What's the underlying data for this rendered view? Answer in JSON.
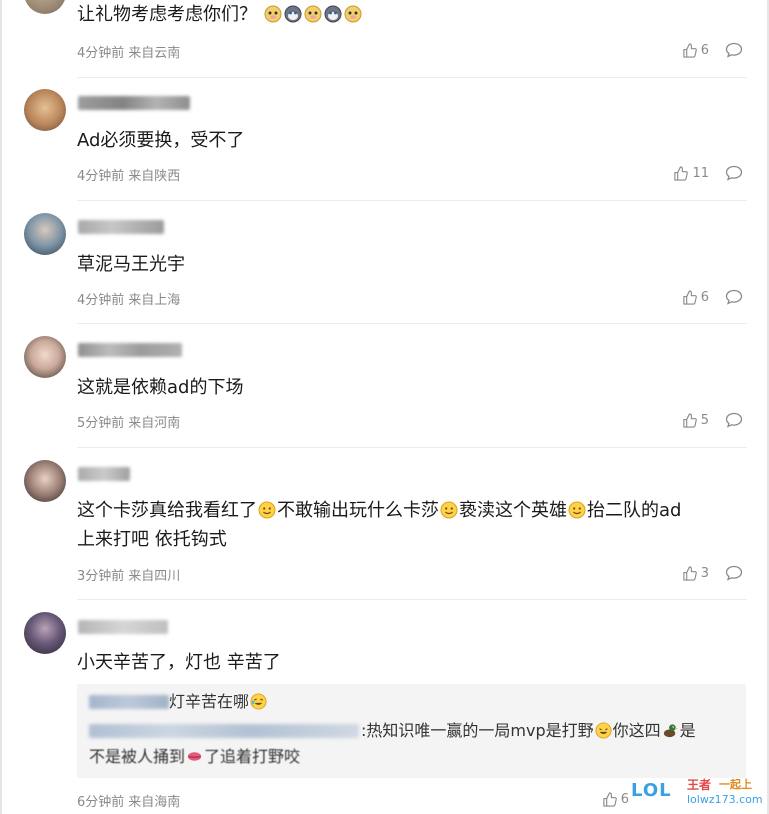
{
  "comments": [
    {
      "text": "让礼物考虑考虑你们？",
      "meta_time": "4分钟前",
      "meta_loc": "来自云南",
      "likes": "6"
    },
    {
      "text": "Ad必须要换，受不了",
      "meta_time": "4分钟前",
      "meta_loc": "来自陕西",
      "likes": "11"
    },
    {
      "text": "草泥马王光宇",
      "meta_time": "4分钟前",
      "meta_loc": "来自上海",
      "likes": "6"
    },
    {
      "text": "这就是依赖ad的下场",
      "meta_time": "5分钟前",
      "meta_loc": "来自河南",
      "likes": "5"
    },
    {
      "text_seg1": "这个卡莎真给我看红了",
      "text_seg2": "不敢输出玩什么卡莎",
      "text_seg3": "亵渎这个英雄",
      "text_seg4": "抬二队的ad",
      "text_line2": "上来打吧 依托钩式",
      "meta_time": "3分钟前",
      "meta_loc": "来自四川",
      "likes": "3"
    },
    {
      "text": "小天辛苦了，灯也 辛苦了",
      "meta_time": "6分钟前",
      "meta_loc": "来自海南",
      "likes": "6",
      "quote": {
        "line1_visible": "灯辛苦在哪",
        "line2_visible_a": ":热知识唯一赢的一局mvp是打野",
        "line2_visible_b": "你这四",
        "line2_visible_c": "是",
        "line3_visible_a": "不是被人捅到",
        "line3_visible_b": "了追着打野咬"
      }
    }
  ],
  "watermark": {
    "lol": "LOL",
    "a": "王者",
    "b": "一起上",
    "c": "lolwz173.com"
  },
  "colors": {
    "text": "#1a1a1a",
    "meta": "#8a8a8a",
    "divider": "#ececec",
    "quote_bg": "#f4f4f4"
  },
  "icons": {
    "like": "thumbs-up-icon",
    "reply": "comment-bubble-icon"
  }
}
